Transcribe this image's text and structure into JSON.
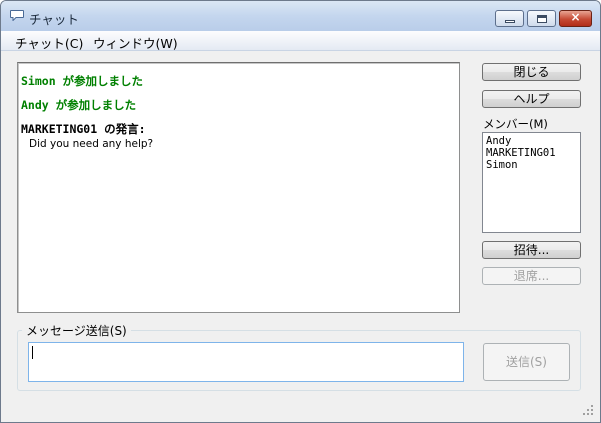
{
  "window": {
    "title": "チャット",
    "icon": "chat-bubble-icon",
    "controls": {
      "minimize": "minimize-icon",
      "maximize": "maximize-icon",
      "close": "×"
    }
  },
  "menu": [
    "チャット(C)",
    "ウィンドウ(W)"
  ],
  "chat": {
    "lines": [
      {
        "text": "Simon が参加しました",
        "kind": "system"
      },
      {
        "text": "Andy が参加しました",
        "kind": "system"
      },
      {
        "text": "MARKETING01 の発言:",
        "kind": "speaker"
      },
      {
        "text": "Did you need any help?",
        "kind": "message"
      }
    ]
  },
  "buttons": {
    "close": "閉じる",
    "help": "ヘルプ",
    "invite": "招待...",
    "leave": "退席...",
    "send": "送信(S)"
  },
  "members": {
    "label": "メンバー(M)",
    "items": [
      "Andy",
      "MARKETING01",
      "Simon"
    ]
  },
  "compose": {
    "label": "メッセージ送信(S)",
    "value": ""
  },
  "colors": {
    "system_text": "#008000",
    "title_bar": "#c4d6ee",
    "close_button": "#c64a34",
    "input_focus_border": "#7eb4ea"
  }
}
